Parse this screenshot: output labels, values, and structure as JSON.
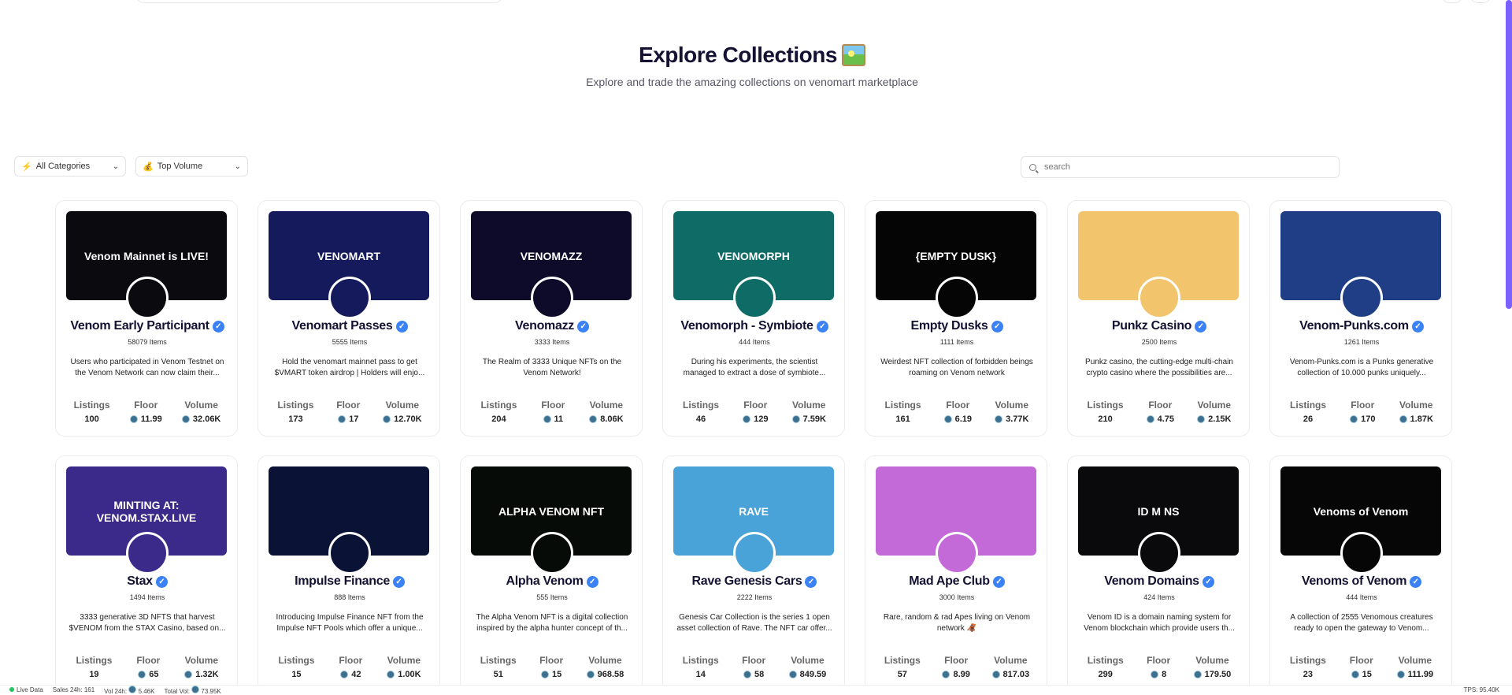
{
  "hero": {
    "title": "Explore Collections",
    "subtitle": "Explore and trade the amazing collections on venomart marketplace"
  },
  "filters": {
    "category": "All Categories",
    "sort": "Top Volume"
  },
  "search": {
    "placeholder": "search"
  },
  "stat_labels": {
    "listings": "Listings",
    "floor": "Floor",
    "volume": "Volume"
  },
  "collections": [
    {
      "name": "Venom Early Participant",
      "items": "58079 Items",
      "desc": "Users who participated in Venom Testnet on the Venom Network can now claim their...",
      "listings": "100",
      "floor": "11.99",
      "volume": "32.06K",
      "banner_text": "Venom Mainnet is LIVE!",
      "banner_bg": "#0b0b0f"
    },
    {
      "name": "Venomart Passes",
      "items": "5555 Items",
      "desc": "Hold the venomart mainnet pass to get $VMART token airdrop | Holders will enjo...",
      "listings": "173",
      "floor": "17",
      "volume": "12.70K",
      "banner_text": "VENOMART",
      "banner_bg": "#151a5c"
    },
    {
      "name": "Venomazz",
      "items": "3333 Items",
      "desc": "The Realm of 3333 Unique NFTs on the Venom Network!",
      "listings": "204",
      "floor": "11",
      "volume": "8.06K",
      "banner_text": "VENOMAZZ",
      "banner_bg": "#0e0a2a"
    },
    {
      "name": "Venomorph - Symbiote",
      "items": "444 Items",
      "desc": "During his experiments, the scientist managed to extract a dose of symbiote...",
      "listings": "46",
      "floor": "129",
      "volume": "7.59K",
      "banner_text": "VENOMORPH",
      "banner_bg": "#0f6b66"
    },
    {
      "name": "Empty Dusks",
      "items": "1111 Items",
      "desc": "Weirdest NFT collection of forbidden beings roaming on Venom network",
      "listings": "161",
      "floor": "6.19",
      "volume": "3.77K",
      "banner_text": "{EMPTY DUSK}",
      "banner_bg": "#050505"
    },
    {
      "name": "Punkz Casino",
      "items": "2500 Items",
      "desc": "Punkz casino, the cutting-edge multi-chain crypto casino where the possibilities are...",
      "listings": "210",
      "floor": "4.75",
      "volume": "2.15K",
      "banner_text": "",
      "banner_bg": "#f2c46b"
    },
    {
      "name": "Venom-Punks.com",
      "items": "1261 Items",
      "desc": "Venom-Punks.com is a Punks generative collection of 10.000 punks uniquely...",
      "listings": "26",
      "floor": "170",
      "volume": "1.87K",
      "banner_text": "",
      "banner_bg": "#1f3e86"
    },
    {
      "name": "Stax",
      "items": "1494 Items",
      "desc": "3333 generative 3D NFTS that harvest $VENOM from the STAX Casino, based on...",
      "listings": "19",
      "floor": "65",
      "volume": "1.32K",
      "banner_text": "MINTING AT: VENOM.STAX.LIVE",
      "banner_bg": "#3b2a8a"
    },
    {
      "name": "Impulse Finance",
      "items": "888 Items",
      "desc": "Introducing Impulse Finance NFT from the Impulse NFT Pools which offer a unique...",
      "listings": "15",
      "floor": "42",
      "volume": "1.00K",
      "banner_text": "",
      "banner_bg": "#0a1335"
    },
    {
      "name": "Alpha Venom",
      "items": "555 Items",
      "desc": "The Alpha Venom NFT is a digital collection inspired by the alpha hunter concept of th...",
      "listings": "51",
      "floor": "15",
      "volume": "968.58",
      "banner_text": "ALPHA VENOM NFT",
      "banner_bg": "#060b07"
    },
    {
      "name": "Rave Genesis Cars",
      "items": "2222 Items",
      "desc": "Genesis Car Collection is the series 1 open asset collection of Rave. The NFT car offer...",
      "listings": "14",
      "floor": "58",
      "volume": "849.59",
      "banner_text": "RAVE",
      "banner_bg": "#4aa3d8"
    },
    {
      "name": "Mad Ape Club",
      "items": "3000 Items",
      "desc": "Rare, random & rad Apes living on Venom network 🦧",
      "listings": "57",
      "floor": "8.99",
      "volume": "817.03",
      "banner_text": "",
      "banner_bg": "#c46ad8"
    },
    {
      "name": "Venom Domains",
      "items": "424 Items",
      "desc": "Venom ID is a domain naming system for Venom blockchain which provide users th...",
      "listings": "299",
      "floor": "8",
      "volume": "179.50",
      "banner_text": "ID M NS",
      "banner_bg": "#0a0a0c"
    },
    {
      "name": "Venoms of Venom",
      "items": "444 Items",
      "desc": "A collection of 2555 Venomous creatures ready to open the gateway to Venom...",
      "listings": "23",
      "floor": "15",
      "volume": "111.99",
      "banner_text": "Venoms of Venom",
      "banner_bg": "#060606"
    }
  ],
  "footer": {
    "live": "Live Data",
    "sales": "Sales 24h: 161",
    "vol": "Vol 24h:",
    "vol_value": "5.46K",
    "total": "Total Vol:",
    "total_value": "73.95K",
    "tps": "TPS: 95.40K"
  }
}
